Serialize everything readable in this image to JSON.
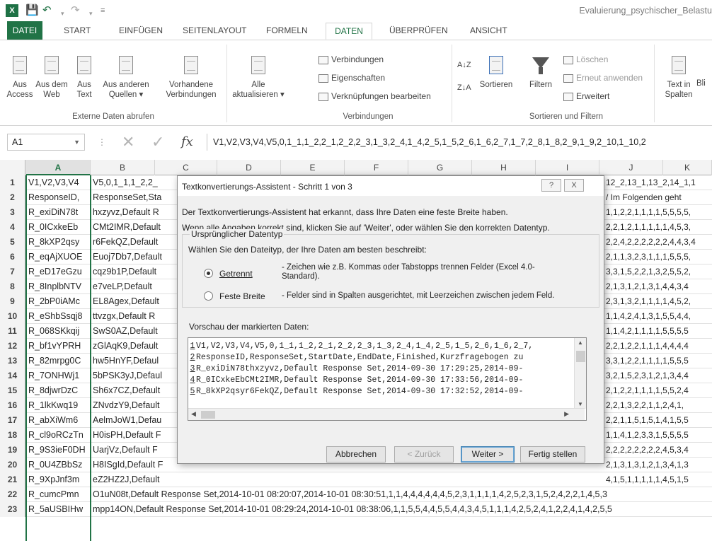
{
  "titlebar": {
    "app_icon": "X",
    "doc_title": "Evaluierung_psychischer_Belastu"
  },
  "tabs": [
    "DATEI",
    "START",
    "EINFÜGEN",
    "SEITENLAYOUT",
    "FORMELN",
    "DATEN",
    "ÜBERPRÜFEN",
    "ANSICHT"
  ],
  "ribbon": {
    "external": {
      "access": [
        "Aus",
        "Access"
      ],
      "web": [
        "Aus dem",
        "Web"
      ],
      "text": [
        "Aus",
        "Text"
      ],
      "other": [
        "Aus anderen",
        "Quellen ▾"
      ],
      "existing": [
        "Vorhandene",
        "Verbindungen"
      ],
      "label": "Externe Daten abrufen"
    },
    "connections": {
      "refresh": [
        "Alle",
        "aktualisieren ▾"
      ],
      "items": [
        "Verbindungen",
        "Eigenschaften",
        "Verknüpfungen bearbeiten"
      ],
      "label": "Verbindungen"
    },
    "sort": {
      "az": "A↓Z",
      "za": "Z↓A",
      "sort_btn": "Sortieren",
      "filter_btn": "Filtern",
      "items": [
        "Löschen",
        "Erneut anwenden",
        "Erweitert"
      ],
      "label": "Sortieren und Filtern"
    },
    "tools": {
      "text_to_columns": [
        "Text in",
        "Spalten"
      ],
      "flash": "Bli"
    }
  },
  "formula_bar": {
    "name_box": "A1",
    "fx": "fx",
    "formula": "V1,V2,V3,V4,V5,0,1_1,1_2,2_1,2_2,2_3,1_3,2_4,1_4,2_5,1_5,2_6,1_6,2_7,1_7,2_8,1_8,2_9,1_9,2_10,1_10,2"
  },
  "columns": [
    "A",
    "B",
    "C",
    "D",
    "E",
    "F",
    "G",
    "H",
    "I",
    "J",
    "K"
  ],
  "rows": [
    {
      "n": "1",
      "a": "V1,V2,V3,V4",
      "b": "V5,0,1_1,1_2,2_",
      "r": "12_2,13_1,13_2,14_1,1"
    },
    {
      "n": "2",
      "a": "ResponseID,",
      "b": "ResponseSet,Sta",
      "r": "/ Im Folgenden geht"
    },
    {
      "n": "3",
      "a": "R_exiDiN78t",
      "b": "hxzyvz,Default R",
      "r": "1,1,2,2,1,1,1,1,5,5,5,5,"
    },
    {
      "n": "4",
      "a": "R_0ICxkeEb",
      "b": "CMt2IMR,Default",
      "r": "2,2,1,2,1,1,1,1,1,4,5,3,"
    },
    {
      "n": "5",
      "a": "R_8kXP2qsy",
      "b": "r6FekQZ,Default",
      "r": "2,2,4,2,2,2,2,2,2,4,4,3,4"
    },
    {
      "n": "6",
      "a": "R_eqAjXUOE",
      "b": "Euoj7Db7,Default",
      "r": "2,1,1,3,2,3,1,1,1,5,5,5,"
    },
    {
      "n": "7",
      "a": "R_eD17eGzu",
      "b": "cqz9b1P,Default",
      "r": "3,3,1,5,2,2,1,3,2,5,5,2,"
    },
    {
      "n": "8",
      "a": "R_8InplbNTV",
      "b": "e7veLP,Default",
      "r": "2,1,3,1,2,1,3,1,4,4,3,4"
    },
    {
      "n": "9",
      "a": "R_2bP0iAMc",
      "b": "EL8Agex,Default",
      "r": "2,3,1,3,2,1,1,1,1,4,5,2,"
    },
    {
      "n": "10",
      "a": "R_eShbSsqj8",
      "b": "ttvzgx,Default R",
      "r": "1,1,4,2,4,1,3,1,5,5,4,4,"
    },
    {
      "n": "11",
      "a": "R_068SKkqij",
      "b": "SwS0AZ,Default",
      "r": "1,1,4,2,1,1,1,1,5,5,5,5"
    },
    {
      "n": "12",
      "a": "R_bf1vYPRH",
      "b": "zGlAqK9,Default",
      "r": "2,2,1,2,2,1,1,1,4,4,4,4"
    },
    {
      "n": "13",
      "a": "R_82mrpg0C",
      "b": "hw5HnYF,Defaul",
      "r": "3,3,1,2,2,1,1,1,1,5,5,5"
    },
    {
      "n": "14",
      "a": "R_7ONHWj1",
      "b": "5bPSK3yJ,Defaul",
      "r": "3,2,1,5,2,3,1,2,1,3,4,4"
    },
    {
      "n": "15",
      "a": "R_8djwrDzC",
      "b": "Sh6x7CZ,Default",
      "r": "2,1,2,2,1,1,1,1,5,5,2,4"
    },
    {
      "n": "16",
      "a": "R_1lkKwq19",
      "b": "ZNvdzY9,Default",
      "r": "2,2,1,3,2,2,1,1,2,4,1,"
    },
    {
      "n": "17",
      "a": "R_abXiWm6",
      "b": "AelmJoW1,Defau",
      "r": "2,2,1,1,5,1,5,1,4,1,5,5"
    },
    {
      "n": "18",
      "a": "R_cl9oRCzTn",
      "b": "H0isPH,Default F",
      "r": "1,1,4,1,2,3,3,1,5,5,5,5"
    },
    {
      "n": "19",
      "a": "R_9S3ieF0DH",
      "b": "UarjVz,Default F",
      "r": "2,2,2,2,2,2,2,2,4,5,3,4"
    },
    {
      "n": "20",
      "a": "R_0U4ZBbSz",
      "b": "H8ISgId,Default F",
      "r": "2,1,3,1,3,1,2,1,3,4,1,3"
    },
    {
      "n": "21",
      "a": "R_9XpJnf3m",
      "b": "eZ2HZ2J,Default",
      "r": "4,1,5,1,1,1,1,1,4,5,1,5"
    }
  ],
  "full_rows": [
    {
      "n": "22",
      "a": "R_cumcPmn",
      "b": "O1uN08t,Default Response Set,2014-10-01 08:20:07,2014-10-01 08:30:51,1,1,4,4,4,4,4,4,5,2,3,1,1,1,1,4,2,5,2,3,1,5,2,4,2,2,1,4,5,3"
    },
    {
      "n": "23",
      "a": "R_5aUSBIHw",
      "b": "mpp14ON,Default Response Set,2014-10-01 08:29:24,2014-10-01 08:38:06,1,1,5,5,4,4,5,5,4,4,3,4,5,1,1,1,4,2,5,2,4,1,2,2,4,1,4,2,5,5"
    }
  ],
  "dialog": {
    "title": "Textkonvertierungs-Assistent - Schritt 1 von 3",
    "help": "?",
    "close": "X",
    "line1": "Der Textkonvertierungs-Assistent hat erkannt, dass Ihre Daten eine feste Breite haben.",
    "line2": "Wenn alle Angaben korrekt sind, klicken Sie auf 'Weiter', oder wählen Sie den korrekten Datentyp.",
    "group_label": "Ursprünglicher Datentyp",
    "group_prompt": "Wählen Sie den Dateityp, der Ihre Daten am besten beschreibt:",
    "option1_label": "Getrennt",
    "option1_desc": "- Zeichen wie z.B. Kommas oder Tabstopps trennen Felder (Excel 4.0-Standard).",
    "option2_label": "Feste Breite",
    "option2_desc": "- Felder sind in Spalten ausgerichtet, mit Leerzeichen zwischen jedem Feld.",
    "preview_label": "Vorschau der markierten Daten:",
    "preview": [
      {
        "n": "1",
        "t": "V1,V2,V3,V4,V5,0,1_1,1_2,2_1,2_2,2_3,1_3,2_4,1_4,2_5,1_5,2_6,1_6,2_7,"
      },
      {
        "n": "2",
        "t": "ResponseID,ResponseSet,StartDate,EndDate,Finished,Kurzfragebogen zu"
      },
      {
        "n": "3",
        "t": "R_exiDiN78thxzyvz,Default Response Set,2014-09-30 17:29:25,2014-09-"
      },
      {
        "n": "4",
        "t": "R_0ICxkeEbCMt2IMR,Default Response Set,2014-09-30 17:33:56,2014-09-"
      },
      {
        "n": "5",
        "t": "R_8kXP2qsyr6FekQZ,Default Response Set,2014-09-30 17:32:52,2014-09-"
      }
    ],
    "buttons": {
      "cancel": "Abbrechen",
      "back": "< Zurück",
      "next": "Weiter >",
      "finish": "Fertig stellen"
    }
  },
  "colors": {
    "excel_green": "#217346",
    "dialog_bg": "#f0f0f0"
  }
}
